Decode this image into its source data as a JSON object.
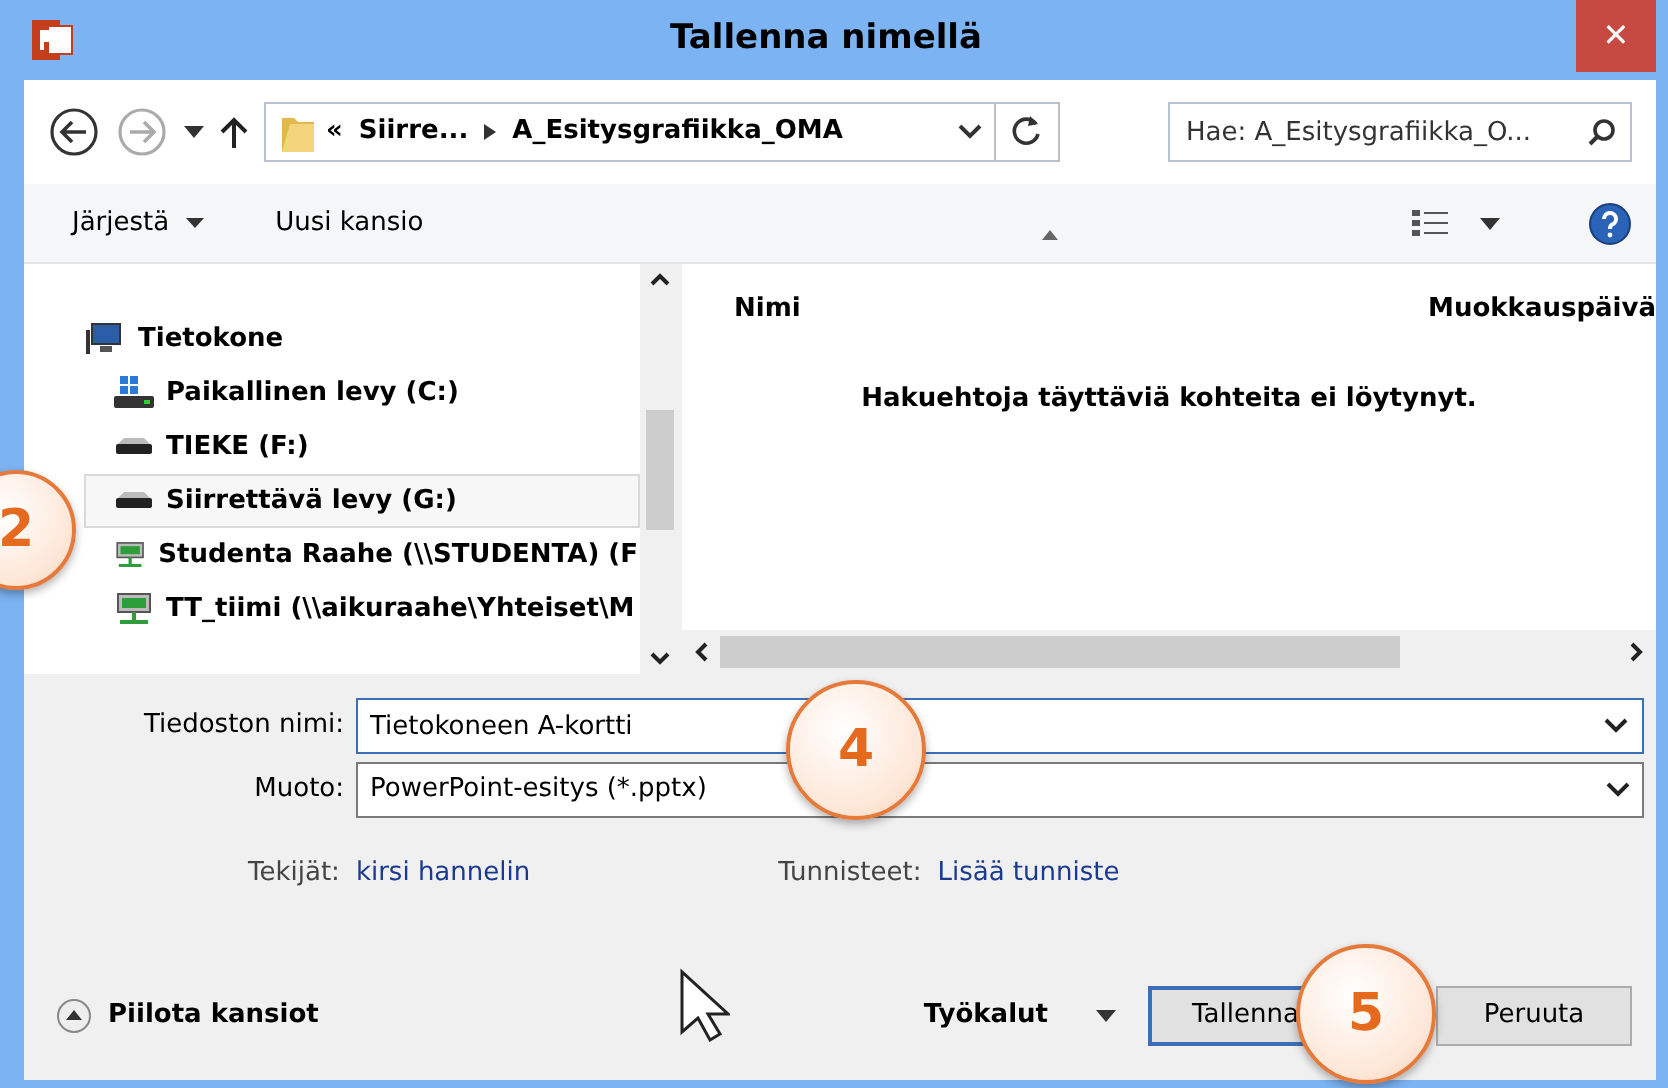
{
  "window": {
    "title": "Tallenna nimellä",
    "close": "✕"
  },
  "address_bar": {
    "path": [
      {
        "text": "«"
      },
      {
        "text": "Siirre..."
      },
      {
        "text": "A_Esitysgrafiikka_OMA"
      }
    ],
    "search_placeholder": "Hae: A_Esitysgrafiikka_O..."
  },
  "toolbar": {
    "organize": "Järjestä",
    "new_folder": "Uusi kansio"
  },
  "nav_tree": [
    {
      "label": "Tietokone",
      "kind": "computer",
      "selected": false,
      "children": [
        {
          "label": "Paikallinen levy (C:)",
          "kind": "system-drive",
          "selected": false
        },
        {
          "label": "TIEKE (F:)",
          "kind": "drive",
          "selected": false
        },
        {
          "label": "Siirrettävä levy (G:)",
          "kind": "drive",
          "selected": true
        },
        {
          "label": "Studenta Raahe (\\\\STUDENTA) (F",
          "kind": "network",
          "selected": false
        },
        {
          "label": "TT_tiimi (\\\\aikuraahe\\Yhteiset\\M",
          "kind": "network",
          "selected": false
        }
      ]
    }
  ],
  "file_list": {
    "columns": [
      "Nimi",
      "Muokkauspäivä"
    ],
    "empty_message": "Hakuehtoja täyttäviä kohteita ei löytynyt."
  },
  "form": {
    "filename_label": "Tiedoston nimi:",
    "filename": "Tietokoneen A-kortti",
    "type_label": "Muoto:",
    "type": "PowerPoint-esitys (*.pptx)",
    "authors_label": "Tekijät:",
    "authors": "kirsi hannelin",
    "tags_label": "Tunnisteet:",
    "tags": "Lisää tunniste"
  },
  "footer": {
    "hide_folders": "Piilota kansiot",
    "tools": "Työkalut",
    "save": "Tallenna",
    "cancel": "Peruuta"
  },
  "callouts": [
    {
      "number": "2"
    },
    {
      "number": "4"
    },
    {
      "number": "5"
    }
  ]
}
